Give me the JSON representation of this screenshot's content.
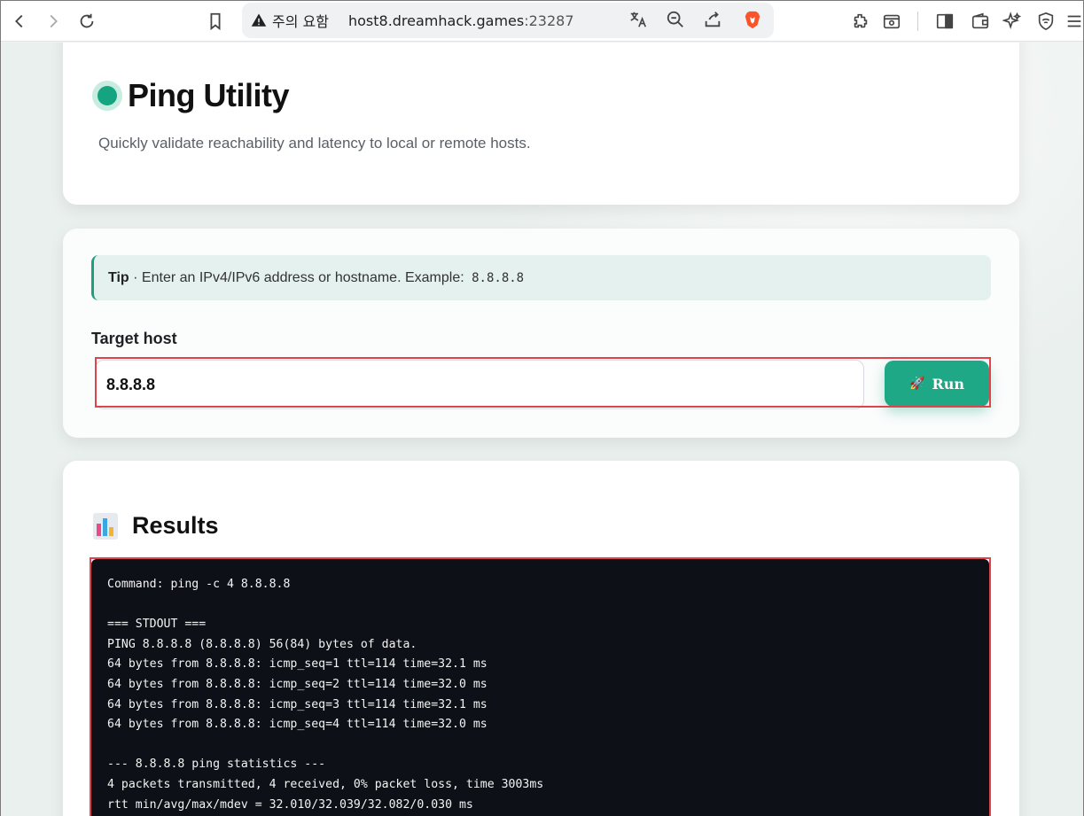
{
  "browser": {
    "security_label": "주의 요함",
    "url_host": "host8.dreamhack.games",
    "url_port": ":23287"
  },
  "header": {
    "title": "Ping Utility",
    "subtitle": "Quickly validate reachability and latency to local or remote hosts."
  },
  "tip": {
    "label": "Tip",
    "text": " · Enter an IPv4/IPv6 address or hostname. Example: ",
    "example": "8.8.8.8"
  },
  "form": {
    "target_label": "Target host",
    "target_value": "8.8.8.8",
    "run_label": "Run",
    "run_icon": "🚀"
  },
  "results": {
    "title": "Results",
    "output_lines": [
      "Command: ping -c 4 8.8.8.8",
      "",
      "=== STDOUT ===",
      "PING 8.8.8.8 (8.8.8.8) 56(84) bytes of data.",
      "64 bytes from 8.8.8.8: icmp_seq=1 ttl=114 time=32.1 ms",
      "64 bytes from 8.8.8.8: icmp_seq=2 ttl=114 time=32.0 ms",
      "64 bytes from 8.8.8.8: icmp_seq=3 ttl=114 time=32.1 ms",
      "64 bytes from 8.8.8.8: icmp_seq=4 ttl=114 time=32.0 ms",
      "",
      "--- 8.8.8.8 ping statistics ---",
      "4 packets transmitted, 4 received, 0% packet loss, time 3003ms",
      "rtt min/avg/max/mdev = 32.010/32.039/32.082/0.030 ms"
    ]
  },
  "colors": {
    "accent": "#1fa886",
    "highlight": "#e0434b",
    "terminal_bg": "#0d1117"
  }
}
